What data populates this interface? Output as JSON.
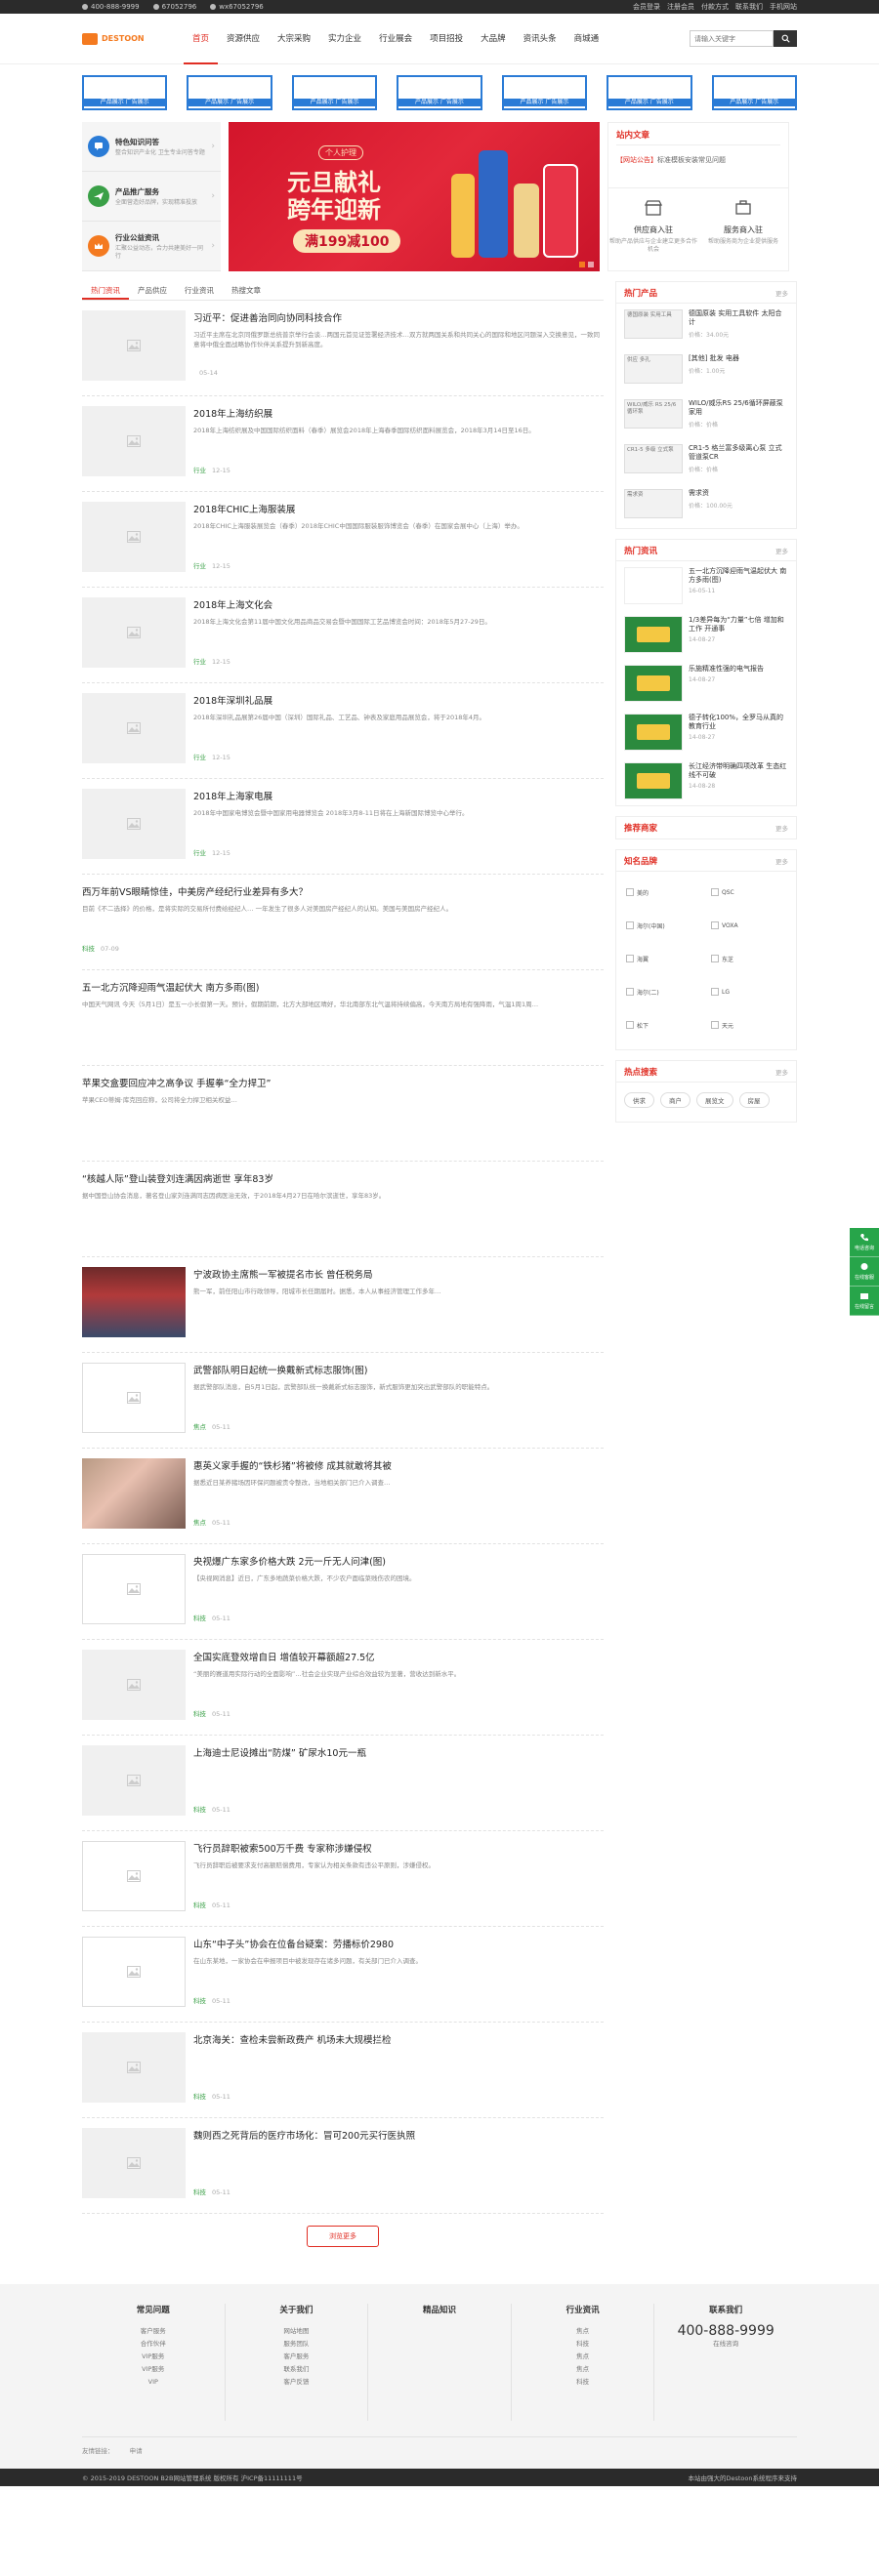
{
  "topbar": {
    "phone": "400-888-9999",
    "qq": "67052796",
    "wechat": "wx67052796",
    "links": [
      "会员登录",
      "注册会员",
      "付款方式",
      "联系我们",
      "手机网站"
    ]
  },
  "header": {
    "logo": "DESTOON",
    "nav": [
      "首页",
      "资源供应",
      "大宗采购",
      "实力企业",
      "行业展会",
      "项目招投",
      "大品牌",
      "资讯头条",
      "商城通"
    ],
    "search_placeholder": "请输入关键字"
  },
  "adstrip": [
    "产品展示 广告展示",
    "产品展示 广告展示",
    "产品展示 广告展示",
    "产品展示 广告展示",
    "产品展示 广告展示",
    "产品展示 广告展示",
    "产品展示 广告展示",
    "产品展示 广告展示"
  ],
  "services": [
    {
      "title": "特色知识问答",
      "desc": "整合知识产业化 卫生专业问答专题",
      "color": "#2a7bd6"
    },
    {
      "title": "产品推广服务",
      "desc": "全面营造好品牌，实现精准投放",
      "color": "#3aa047"
    },
    {
      "title": "行业公益资讯",
      "desc": "汇聚公益动态，合力共建美好一同行",
      "color": "#f47a20"
    }
  ],
  "banner": {
    "tag": "个人护理",
    "title_line1": "元旦献礼",
    "title_line2": "跨年迎新",
    "pill": "满199减100"
  },
  "notice": {
    "heading": "站内文章",
    "tag": "【网站公告】",
    "text": "标准模板安装常见问题"
  },
  "joins": [
    {
      "title": "供应商入驻",
      "desc": "帮助产品供应与企业建立更多合作机会"
    },
    {
      "title": "服务商入驻",
      "desc": "帮助服务商为企业提供服务"
    }
  ],
  "tabs": [
    "热门资讯",
    "产品供应",
    "行业资讯",
    "热搜文章"
  ],
  "articles": [
    {
      "title": "习近平：促进善治同向协同科技合作",
      "desc": "习近平主席在北京同俄罗斯总统普京举行会谈…两国元首见证签署经济技术…双方就两国关系和共同关心的国际和地区问题深入交换意见，一致同意将中俄全面战略协作伙伴关系提升到新高度。",
      "meta_tag": "",
      "date": "05-14",
      "img": "placeholder"
    },
    {
      "title": "2018年上海纺织展",
      "desc": "2018年上海纺织展及中国国际纺织面料（春季）展览会2018年上海春季国际纺织面料展览会，2018年3月14日至16日。",
      "meta_tag": "行业",
      "date": "12-15",
      "img": "placeholder"
    },
    {
      "title": "2018年CHIC上海服装展",
      "desc": "2018年CHIC上海服装展览会（春季）2018年CHIC中国国际服装服饰博览会（春季）在国家会展中心（上海）举办。",
      "meta_tag": "行业",
      "date": "12-15",
      "img": "placeholder"
    },
    {
      "title": "2018年上海文化会",
      "desc": "2018年上海文化会第11届中国文化用品商品交易会暨中国国际工艺品博览会时间：2018年5月27-29日。",
      "meta_tag": "行业",
      "date": "12-15",
      "img": "placeholder"
    },
    {
      "title": "2018年深圳礼品展",
      "desc": "2018年深圳礼品展第26届中国（深圳）国际礼品、工艺品、钟表及家庭用品展览会，将于2018年4月。",
      "meta_tag": "行业",
      "date": "12-15",
      "img": "placeholder"
    },
    {
      "title": "2018年上海家电展",
      "desc": "2018年中国家电博览会暨中国家用电器博览会 2018年3月8-11日将在上海新国际博览中心举行。",
      "meta_tag": "行业",
      "date": "12-15",
      "img": "placeholder"
    },
    {
      "title": "西万年前VS眼睛惊佳，中美房产经纪行业差异有多大？",
      "desc": "目前《不二选择》的价格，是将实际的交易所付费给经纪人… 一年发生了很多人对美国房产经纪人的认知。美国与美国房产经纪人。",
      "meta_tag": "科技",
      "date": "07-09",
      "img": "none"
    },
    {
      "title": "五一北方沉降迎雨气温起伏大 南方多雨(图)",
      "desc": "中国天气网讯 今天（5月1日）是五一小长假第一天。预计，假期前期，北方大部地区晴好，华北南部东北气温将持续偏高，今天南方局地有强降雨，气温1周1周…",
      "meta_tag": "",
      "date": "",
      "img": "none"
    },
    {
      "title": "苹果交盒要回应冲之高争议 手握拳“全力捍卫”",
      "desc": "苹果CEO蒂姆·库克回应称，公司将全力捍卫相关权益…",
      "meta_tag": "",
      "date": "",
      "img": "none"
    },
    {
      "title": "“核越人际”登山装登刘连满因病逝世 享年83岁",
      "desc": "据中国登山协会消息，著名登山家刘连满同志因病医治无效，于2018年4月27日在哈尔滨逝世，享年83岁。",
      "meta_tag": "",
      "date": "",
      "img": "none"
    },
    {
      "title": "宁波政协主席熊一军被提名市长 曾任税务局",
      "desc": "熊一军，前任阳山市行政领导，阳城市长任期届时。据悉，本人从事经济管理工作多年…",
      "meta_tag": "",
      "date": "",
      "img": "photo1"
    },
    {
      "title": "武警部队明日起统一换戴新式标志服饰(图)",
      "desc": "据武警部队消息，自5月1日起，武警部队统一换戴新式标志服饰，新式服饰更加突出武警部队的职能特点。",
      "meta_tag": "焦点",
      "date": "05-11",
      "img": "border"
    },
    {
      "title": "惠英义家手握的“铁杉猪”将被修 成其就敢将其被",
      "desc": "据悉近日某养猪场因环保问题被责令整改，当地相关部门已介入调查…",
      "meta_tag": "焦点",
      "date": "05-11",
      "img": "photo2"
    },
    {
      "title": "央视爆广东家多价格大跌 2元一斤无人问津(图)",
      "desc": "【央视网消息】近日，广东多地蔬菜价格大跌，不少农户面临菜贱伤农的困境。",
      "meta_tag": "科技",
      "date": "05-11",
      "img": "border"
    },
    {
      "title": "全国实底登效增自日 增值较开幕额超27.5亿",
      "desc": "“美丽的赛道用实际行动的全面影响”…社会企业实现产业综合效益较为显著，营收达到新水平。",
      "meta_tag": "科技",
      "date": "05-11",
      "img": "placeholder"
    },
    {
      "title": "上海迪士尼设摊出“防煤” 矿尿水10元一瓶",
      "desc": "",
      "meta_tag": "科技",
      "date": "05-11",
      "img": "placeholder"
    },
    {
      "title": "飞行员辞职被索500万千费 专家称涉嫌侵权",
      "desc": "飞行员辞职后被要求支付高额赔偿费用，专家认为相关条款有违公平原则，涉嫌侵权。",
      "meta_tag": "科技",
      "date": "05-11",
      "img": "border"
    },
    {
      "title": "山东“中子头”协会在位备台疑案：劳播标价2980",
      "desc": "在山东某地，一家协会在申报项目中被发现存在诸多问题，有关部门已介入调查。",
      "meta_tag": "科技",
      "date": "05-11",
      "img": "border"
    },
    {
      "title": "北京海关：查检未尝新政费产 机场未大规模拦检",
      "desc": "",
      "meta_tag": "科技",
      "date": "05-11",
      "img": "placeholder"
    },
    {
      "title": "魏则西之死背后的医疗市场化：冒可200元买行医执照",
      "desc": "",
      "meta_tag": "科技",
      "date": "05-11",
      "img": "placeholder"
    }
  ],
  "more_button": "浏览更多",
  "hot_products": {
    "heading": "热门产品",
    "more": "更多",
    "items": [
      {
        "img_text": "德国原装 实用工具",
        "name": "德国原装 实用工具软件 太阳合计",
        "price": "价格：34.00元"
      },
      {
        "img_text": "供应 多孔",
        "name": "[其他] 批发 电器",
        "price": "价格：1.00元"
      },
      {
        "img_text": "WILO/威乐 RS 25/6 循环泵",
        "name": "WILO/威乐RS 25/6循环屏蔽泵 家用",
        "price": "价格：价格"
      },
      {
        "img_text": "CR1-5 多级 立式泵",
        "name": "CR1-5 格兰富多级离心泵 立式管道泵CR",
        "price": "价格：价格"
      },
      {
        "img_text": "需求资",
        "name": "需求资",
        "price": "价格：100.00元"
      }
    ]
  },
  "hot_news": {
    "heading": "热门资讯",
    "more": "更多",
    "items": [
      {
        "title": "五一北方沉降迎雨气温起伏大 南方多雨(图)",
        "date": "16-05-11",
        "img": "white"
      },
      {
        "title": "1/3差异每为“力量”七倍 增加和工作 开通事",
        "date": "14-08-27",
        "img": "green"
      },
      {
        "title": "乐施精准性强的电气报告",
        "date": "14-08-27",
        "img": "green"
      },
      {
        "title": "德子转化100%，全罗马从真的教育行业",
        "date": "14-08-27",
        "img": "green"
      },
      {
        "title": "长江经济带明确四项改革 生态红线不可破",
        "date": "14-08-28",
        "img": "green"
      }
    ]
  },
  "recommend_merchants": {
    "heading": "推荐商家",
    "more": "更多"
  },
  "brands": {
    "heading": "知名品牌",
    "more": "更多",
    "items": [
      "美的",
      "QSC",
      "海尔(中国)",
      "VOXA",
      "海翼",
      "东芝",
      "海尔(二)",
      "LG",
      "松下",
      "天元"
    ]
  },
  "hot_search": {
    "heading": "热点搜索",
    "more": "更多",
    "items": [
      "供求",
      "商户",
      "展览文",
      "房屋"
    ]
  },
  "float_widget": [
    "电话咨询",
    "在线客服",
    "在线留言"
  ],
  "footer": {
    "cols": [
      {
        "heading": "常见问题",
        "items": [
          "客户服务",
          "合作伙伴",
          "VIP服务",
          "VIP服务",
          "VIP"
        ]
      },
      {
        "heading": "关于我们",
        "items": [
          "网站地图",
          "服务团队",
          "客户服务",
          "联系我们",
          "客户反馈"
        ]
      },
      {
        "heading": "精品知识",
        "items": []
      },
      {
        "heading": "行业资讯",
        "items": [
          "焦点",
          "科技",
          "焦点",
          "焦点",
          "科技"
        ]
      },
      {
        "heading": "联系我们",
        "items": [
          "400-888-9999",
          "在线咨询"
        ]
      }
    ],
    "links_label": "友情链接：",
    "links": [
      "申请"
    ],
    "copyright_left": "© 2015-2019 DESTOON B2B网站管理系统 版权所有 沪ICP备11111111号",
    "copyright_right": "本站由强大的Destoon系统程序来支持"
  }
}
